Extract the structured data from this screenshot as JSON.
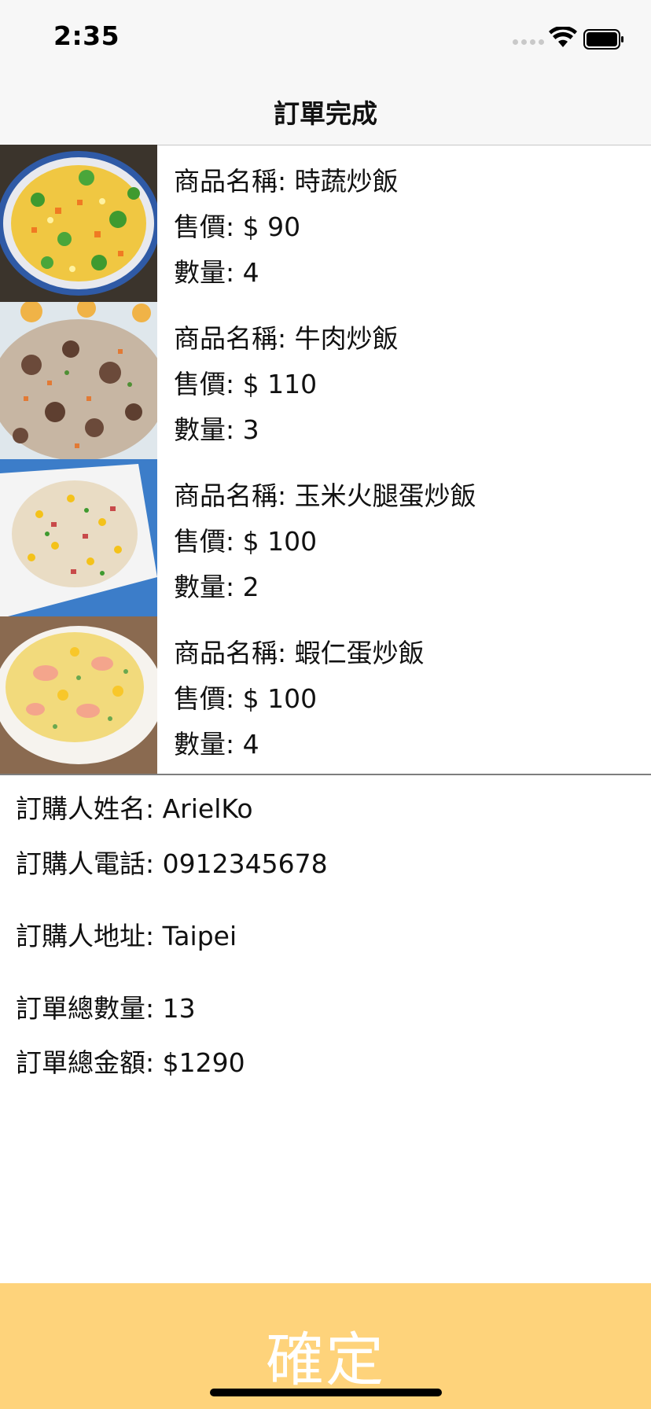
{
  "status_bar": {
    "time": "2:35"
  },
  "nav": {
    "title": "訂單完成"
  },
  "items": [
    {
      "name": "商品名稱: 時蔬炒飯",
      "price": "售價: $ 90",
      "quantity": "數量: 4",
      "image": "vegetable-fried-rice-photo"
    },
    {
      "name": "商品名稱: 牛肉炒飯",
      "price": "售價: $ 110",
      "quantity": "數量: 3",
      "image": "beef-fried-rice-photo"
    },
    {
      "name": "商品名稱: 玉米火腿蛋炒飯",
      "price": "售價: $ 100",
      "quantity": "數量: 2",
      "image": "corn-ham-egg-fried-rice-photo"
    },
    {
      "name": "商品名稱: 蝦仁蛋炒飯",
      "price": "售價: $ 100",
      "quantity": "數量: 4",
      "image": "shrimp-egg-fried-rice-photo"
    }
  ],
  "order_info": {
    "buyer_name": "訂購人姓名: ArielKo",
    "buyer_phone": "訂購人電話: 0912345678",
    "buyer_address": "訂購人地址: Taipei",
    "total_quantity": "訂單總數量: 13",
    "total_amount": "訂單總金額: $1290"
  },
  "confirm_button": {
    "label": "確定",
    "color": "#fed37b"
  }
}
